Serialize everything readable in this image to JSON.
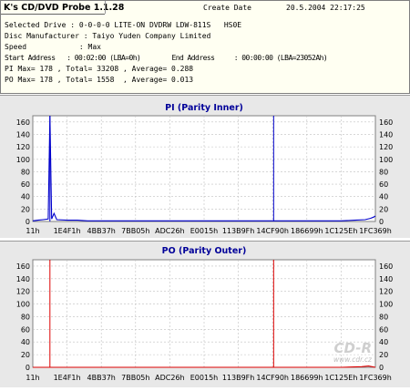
{
  "app": {
    "title": "K's CD/DVD Probe 1.1.28"
  },
  "header": {
    "create_date_label": "Create Date",
    "create_date_value": "20.5.2004 22:17:25",
    "lines": [
      "Selected Drive : 0-0-0-0 LITE-ON DVDRW LDW-811S   HS0E",
      "Disc Manufacturer : Taiyo Yuden Company Limited",
      "Speed            : Max",
      "Start Address   : 00:02:00 (LBA=0h)        End Address     : 00:00:00 (LBA=23052Ah)",
      "PI Max= 178 , Total= 33208 , Average= 0.288",
      "PO Max= 178 , Total= 1558  , Average= 0.013"
    ]
  },
  "watermark": {
    "logo": "CD-R",
    "url": "www.cdr.cz"
  },
  "colors": {
    "pi_line": "#0000cc",
    "po_line": "#dd0000",
    "grid": "#c0c0c0",
    "plot_bg": "#ffffff",
    "panel_bg": "#e8e8e8",
    "title_blue": "#000099"
  },
  "chart_data": [
    {
      "type": "line",
      "title": "PI (Parity Inner)",
      "x_tick_labels": [
        "11h",
        "1E4F1h",
        "4BB37h",
        "7BB05h",
        "ADC26h",
        "E0015h",
        "113B9Fh",
        "14CF90h",
        "186699h",
        "1C125Eh",
        "1FC369h"
      ],
      "ylim": [
        0,
        170
      ],
      "y_ticks": [
        0,
        20,
        40,
        60,
        80,
        100,
        120,
        140,
        160
      ],
      "grid": true,
      "series": [
        {
          "x_index": [
            0.0,
            0.15,
            0.3,
            0.45,
            0.5,
            0.55,
            0.62,
            0.7,
            1.0,
            1.3,
            1.6,
            2.0,
            2.5,
            3.0,
            3.5,
            4.0,
            4.5,
            5.0,
            5.5,
            6.0,
            6.5,
            7.0,
            7.5,
            8.0,
            8.5,
            9.0,
            9.4,
            9.7,
            9.85,
            9.95,
            10.0
          ],
          "values": [
            1,
            2,
            3,
            4,
            170,
            4,
            13,
            3,
            2,
            2,
            1,
            1,
            1,
            1,
            1,
            1,
            1,
            1,
            1,
            1,
            1,
            1,
            1,
            1,
            1,
            1,
            2,
            3,
            5,
            7,
            9
          ]
        }
      ],
      "spikes": [
        {
          "x_index": 0.5,
          "value": 170
        },
        {
          "x_index": 7.03,
          "value": 170
        }
      ]
    },
    {
      "type": "line",
      "title": "PO (Parity Outer)",
      "x_tick_labels": [
        "11h",
        "1E4F1h",
        "4BB37h",
        "7BB05h",
        "ADC26h",
        "E0015h",
        "113B9Fh",
        "14CF90h",
        "186699h",
        "1C125Eh",
        "1FC369h"
      ],
      "ylim": [
        0,
        170
      ],
      "y_ticks": [
        0,
        20,
        40,
        60,
        80,
        100,
        120,
        140,
        160
      ],
      "grid": true,
      "series": [
        {
          "x_index": [
            0.0,
            2.0,
            4.0,
            6.0,
            8.0,
            9.0,
            9.6,
            9.8,
            10.0
          ],
          "values": [
            0,
            0,
            0,
            0,
            0,
            0,
            1,
            2,
            0
          ]
        }
      ],
      "spikes": [
        {
          "x_index": 0.5,
          "value": 170
        },
        {
          "x_index": 7.03,
          "value": 170
        }
      ]
    }
  ]
}
